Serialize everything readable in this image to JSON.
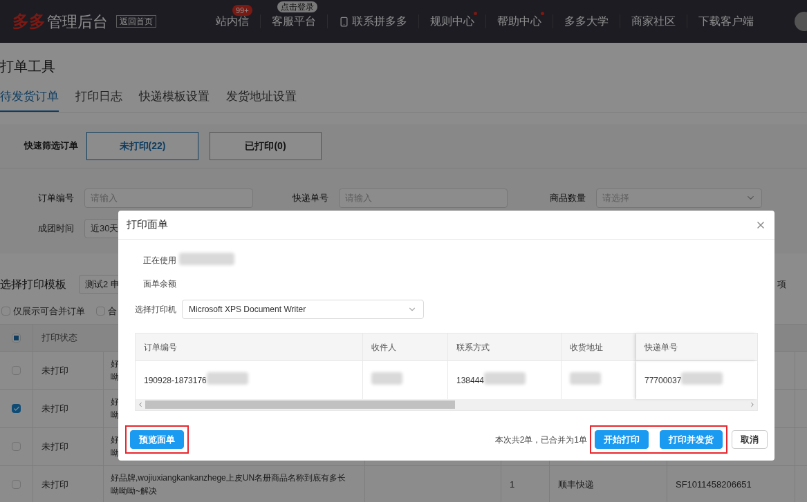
{
  "nav": {
    "brand": "多多",
    "brand_suffix": "管理后台",
    "home_button": "返回首页",
    "items": [
      {
        "label": "站内信",
        "badge": "99+",
        "dot": false
      },
      {
        "label": "客服平台",
        "tooltip": "点击登录",
        "dot": false
      },
      {
        "label": "联系拼多多",
        "kind": "phone",
        "dot": false
      },
      {
        "label": "规则中心",
        "dot": true
      },
      {
        "label": "帮助中心",
        "dot": true
      },
      {
        "label": "多多大学",
        "dot": false
      },
      {
        "label": "商家社区",
        "dot": false
      },
      {
        "label": "下载客户端",
        "dot": false
      }
    ]
  },
  "page_title": "打单工具",
  "tabs": [
    {
      "label": "待发货订单",
      "selected": true
    },
    {
      "label": "打印日志",
      "selected": false
    },
    {
      "label": "快递模板设置",
      "selected": false
    },
    {
      "label": "发货地址设置",
      "selected": false
    }
  ],
  "quick_filter": {
    "label": "快速筛选订单",
    "options": [
      {
        "label": "未打印(22)",
        "selected": true
      },
      {
        "label": "已打印(0)",
        "selected": false
      }
    ]
  },
  "filters": [
    {
      "label": "订单编号",
      "kind": "input",
      "placeholder": "请输入"
    },
    {
      "label": "快递单号",
      "kind": "input",
      "placeholder": "请输入"
    },
    {
      "label": "商品数量",
      "kind": "select",
      "placeholder": "请选择"
    },
    {
      "label": "成团时间",
      "kind": "select",
      "value": "近30天"
    }
  ],
  "template": {
    "label": "选择打印模板",
    "value": "测试2 申",
    "right_label": "项"
  },
  "options": [
    {
      "label": "仅展示可合并订单",
      "checked": false
    },
    {
      "label": "合",
      "checked": false
    }
  ],
  "orders": {
    "header_indeterminate": true,
    "columns": [
      "打印状态"
    ],
    "rows": [
      {
        "checked": false,
        "status": "未打印",
        "product": [
          "好",
          "呦"
        ]
      },
      {
        "checked": true,
        "status": "未打印",
        "product": [
          "好",
          "呦"
        ]
      },
      {
        "checked": false,
        "status": "未打印",
        "product": [
          "好",
          "呦"
        ]
      },
      {
        "checked": false,
        "status": "未打印",
        "product": [
          "好品牌,wojiuxiangkankanzhege上皮UN名册商品名称到底有多长",
          "呦呦呦~解决"
        ],
        "quantity": "1",
        "courier": "顺丰快递",
        "tracking": "SF1011458206651"
      }
    ]
  },
  "modal": {
    "title": "打印面单",
    "info": [
      {
        "label": "正在使用",
        "redacted": true
      },
      {
        "label": "面单余额",
        "redacted": false
      }
    ],
    "printer": {
      "label": "选择打印机",
      "value": "Microsoft XPS Document Writer"
    },
    "columns": [
      "订单编号",
      "收件人",
      "联系方式",
      "收货地址",
      "快递单号"
    ],
    "row": [
      {
        "text": "190928-1873176",
        "redacted": true
      },
      {
        "redacted": true
      },
      {
        "text": "138444",
        "redacted": true
      },
      {
        "redacted": true
      },
      {
        "text": "77700037",
        "redacted": true
      }
    ],
    "footer": {
      "left": {
        "highlighted": true,
        "buttons": [
          {
            "label": "预览面单",
            "kind": "primary"
          }
        ]
      },
      "summary": "本次共2单，已合并为1单",
      "right": {
        "highlighted": true,
        "buttons": [
          {
            "label": "开始打印",
            "kind": "primary"
          },
          {
            "label": "打印并发货",
            "kind": "primary"
          }
        ]
      },
      "cancel": {
        "label": "取消",
        "kind": "default"
      }
    }
  }
}
